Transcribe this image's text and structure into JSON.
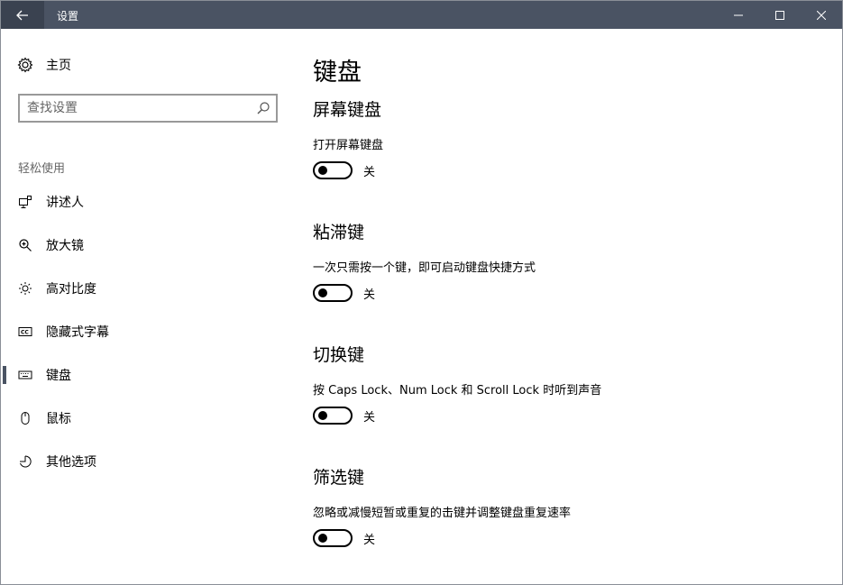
{
  "window": {
    "title": "设置"
  },
  "sidebar": {
    "home_label": "主页",
    "search_placeholder": "查找设置",
    "section_label": "轻松使用",
    "items": [
      {
        "label": "讲述人",
        "icon": "narrator-icon"
      },
      {
        "label": "放大镜",
        "icon": "magnifier-icon"
      },
      {
        "label": "高对比度",
        "icon": "high-contrast-icon"
      },
      {
        "label": "隐藏式字幕",
        "icon": "closed-captions-icon"
      },
      {
        "label": "键盘",
        "icon": "keyboard-icon",
        "active": true
      },
      {
        "label": "鼠标",
        "icon": "mouse-icon"
      },
      {
        "label": "其他选项",
        "icon": "other-options-icon"
      }
    ]
  },
  "main": {
    "title": "键盘",
    "groups": [
      {
        "title": "屏幕键盘",
        "description": "打开屏幕键盘",
        "state": "关"
      },
      {
        "title": "粘滞键",
        "description": "一次只需按一个键，即可启动键盘快捷方式",
        "state": "关"
      },
      {
        "title": "切换键",
        "description": "按 Caps Lock、Num Lock 和 Scroll Lock 时听到声音",
        "state": "关"
      },
      {
        "title": "筛选键",
        "description": "忽略或减慢短暂或重复的击键并调整键盘重复速率",
        "state": "关"
      }
    ]
  },
  "colors": {
    "titlebar": "#4a5363",
    "accent": "#4a5363"
  }
}
